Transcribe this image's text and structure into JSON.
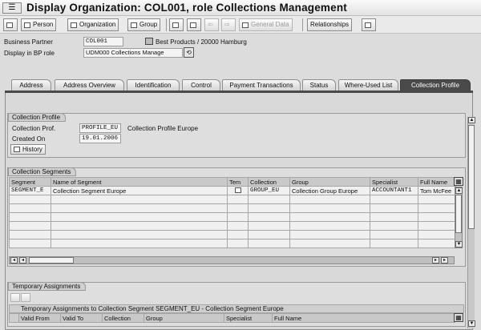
{
  "window": {
    "title": "Display Organization: COL001, role Collections Management"
  },
  "toolbar": {
    "person_label": "Person",
    "organization_label": "Organization",
    "group_label": "Group",
    "general_data_label": "General Data",
    "relationships_label": "Relationships"
  },
  "header": {
    "bp_label": "Business Partner",
    "bp_value": "COL001",
    "bp_description": "Best Products / 20000 Hamburg",
    "role_label": "Display in BP role",
    "role_value": "UDM000 Collections Manage"
  },
  "tabs": [
    {
      "label": "Address"
    },
    {
      "label": "Address Overview"
    },
    {
      "label": "Identification"
    },
    {
      "label": "Control"
    },
    {
      "label": "Payment Transactions"
    },
    {
      "label": "Status"
    },
    {
      "label": "Where-Used List"
    },
    {
      "label": "Collection Profile"
    }
  ],
  "collection_profile": {
    "title": "Collection Profile",
    "prof_label": "Collection Prof.",
    "prof_value": "PROFILE_EU",
    "prof_description": "Collection Profile Europe",
    "created_label": "Created On",
    "created_value": "19.01.2006",
    "history_label": "History"
  },
  "collection_segments": {
    "title": "Collection Segments",
    "columns": [
      "Segment",
      "Name of Segment",
      "Tem",
      "Collection",
      "Group",
      "Specialist",
      "Full Name"
    ],
    "rows": [
      {
        "segment": "SEGMENT_E",
        "name": "Collection Segment Europe",
        "collection": "GROUP_EU",
        "group": "Collection Group Europe",
        "specialist": "ACCOUNTANT1",
        "full_name": "Tom McFee"
      }
    ]
  },
  "temporary_assignments": {
    "title": "Temporary Assignments",
    "caption": "Temporary Assignments to Collection Segment SEGMENT_EU - Collection Segment Europe",
    "columns": [
      "Valid From",
      "Valid To",
      "Collection",
      "Group",
      "Specialist",
      "Full Name"
    ]
  },
  "colors": {
    "active_tab": "#4a4a4a",
    "background": "#dcdcdc"
  }
}
